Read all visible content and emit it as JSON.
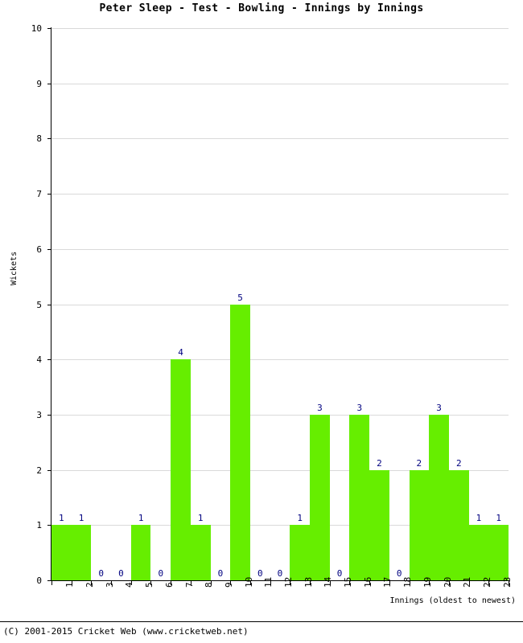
{
  "chart_data": {
    "type": "bar",
    "title": "Peter Sleep - Test - Bowling - Innings by Innings",
    "xlabel": "Innings (oldest to newest)",
    "ylabel": "Wickets",
    "categories": [
      "1",
      "2",
      "3",
      "4",
      "5",
      "6",
      "7",
      "8",
      "9",
      "10",
      "11",
      "12",
      "13",
      "14",
      "15",
      "16",
      "17",
      "18",
      "19",
      "20",
      "21",
      "22",
      "23"
    ],
    "values": [
      1,
      1,
      0,
      0,
      1,
      0,
      4,
      1,
      0,
      5,
      0,
      0,
      1,
      3,
      0,
      3,
      2,
      0,
      2,
      3,
      2,
      1,
      1
    ],
    "value_labels": [
      "1",
      "1",
      "0",
      "0",
      "1",
      "0",
      "4",
      "1",
      "0",
      "5",
      "0",
      "0",
      "1",
      "3",
      "0",
      "3",
      "2",
      "0",
      "2",
      "3",
      "2",
      "1",
      "1"
    ],
    "ylim": [
      0,
      10
    ],
    "y_ticks": [
      "0",
      "1",
      "2",
      "3",
      "4",
      "5",
      "6",
      "7",
      "8",
      "9",
      "10"
    ],
    "grid": true,
    "legend": "none",
    "bar_color": "#66ee00",
    "value_label_color": "#000080",
    "grid_color": "#d9d9d9",
    "axis_color": "#000000"
  },
  "footer": {
    "copyright": "(C) 2001-2015 Cricket Web (www.cricketweb.net)"
  }
}
